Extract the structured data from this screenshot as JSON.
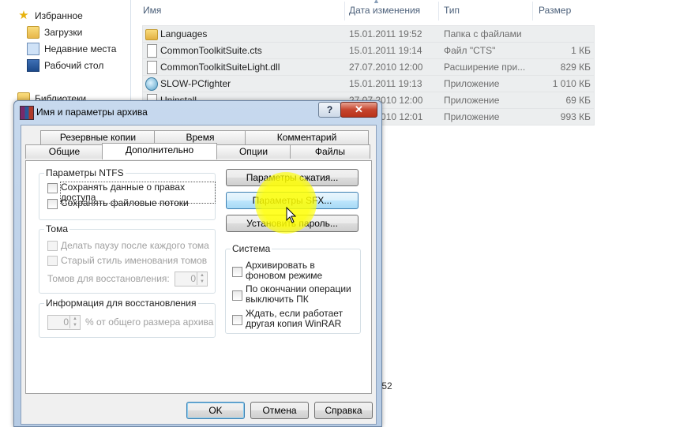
{
  "explorer": {
    "nav": [
      {
        "label": "Избранное",
        "icon": "star-icon"
      },
      {
        "label": "Загрузки",
        "icon": "folder-icon"
      },
      {
        "label": "Недавние места",
        "icon": "recent-places-icon"
      },
      {
        "label": "Рабочий стол",
        "icon": "desktop-icon"
      },
      {
        "label": "Библиотеки",
        "icon": "library-icon"
      }
    ],
    "columns": {
      "name": "Имя",
      "date": "Дата изменения",
      "type": "Тип",
      "size": "Размер"
    },
    "files": [
      {
        "name": "Languages",
        "date": "15.01.2011 19:52",
        "type": "Папка с файлами",
        "size": ""
      },
      {
        "name": "CommonToolkitSuite.cts",
        "date": "15.01.2011 19:14",
        "type": "Файл \"CTS\"",
        "size": "1 КБ"
      },
      {
        "name": "CommonToolkitSuiteLight.dll",
        "date": "27.07.2010 12:00",
        "type": "Расширение при...",
        "size": "829 КБ"
      },
      {
        "name": "SLOW-PCfighter",
        "date": "15.01.2011 19:13",
        "type": "Приложение",
        "size": "1 010 КБ"
      },
      {
        "name": "Uninstall",
        "date": "27.07.2010 12:00",
        "type": "Приложение",
        "size": "69 КБ"
      },
      {
        "name": "",
        "date": "27.07.2010 12:01",
        "type": "Приложение",
        "size": "993 КБ"
      }
    ],
    "status_partial": ":52"
  },
  "dialog": {
    "title": "Имя и параметры архива",
    "tabs_back": [
      "Резервные копии",
      "Время",
      "Комментарий"
    ],
    "tabs_front": [
      "Общие",
      "Дополнительно",
      "Опции",
      "Файлы"
    ],
    "active_tab": "Дополнительно",
    "ntfs": {
      "title": "Параметры NTFS",
      "save_security": "Сохранять данные о правах доступа",
      "save_streams": "Сохранять файловые потоки"
    },
    "volumes": {
      "title": "Тома",
      "pause": "Делать паузу после каждого тома",
      "old_style": "Старый стиль именования томов",
      "recovery_volumes_label": "Томов для восстановления:",
      "recovery_volumes_value": "0"
    },
    "recovery": {
      "title": "Информация для восстановления",
      "value": "0",
      "suffix": "% от общего размера архива"
    },
    "buttons": {
      "compression": "Параметры сжатия...",
      "sfx": "Параметры SFX...",
      "password": "Установить пароль...",
      "ok": "OK",
      "cancel": "Отмена",
      "help": "Справка"
    },
    "system": {
      "title": "Система",
      "background": "Архивировать в фоновом режиме",
      "shutdown": "По окончании операции выключить ПК",
      "wait": "Ждать, если работает другая копия WinRAR"
    },
    "titlebar": {
      "help": "?",
      "close": "✕"
    }
  }
}
